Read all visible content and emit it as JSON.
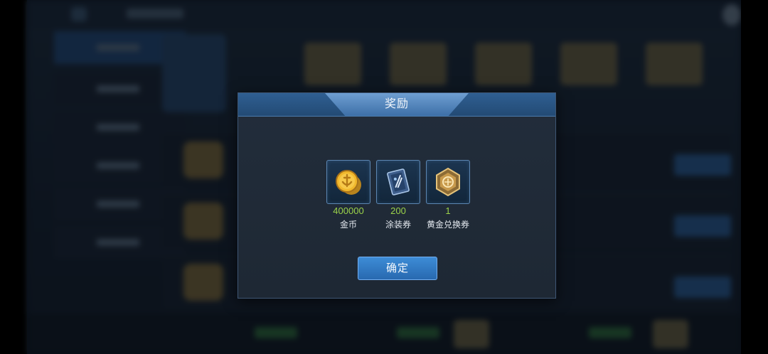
{
  "dialog": {
    "title": "奖励",
    "confirm_label": "确定",
    "rewards": [
      {
        "amount": "400000",
        "name": "金币",
        "icon": "gold-coin-icon"
      },
      {
        "amount": "200",
        "name": "涂装券",
        "icon": "skin-voucher-icon"
      },
      {
        "amount": "1",
        "name": "黄金兑换券",
        "icon": "gold-exchange-voucher-icon"
      }
    ]
  },
  "colors": {
    "accent_blue": "#2f5f92",
    "amount_green": "#9bd24a",
    "button_blue": "#3d8cd6"
  }
}
